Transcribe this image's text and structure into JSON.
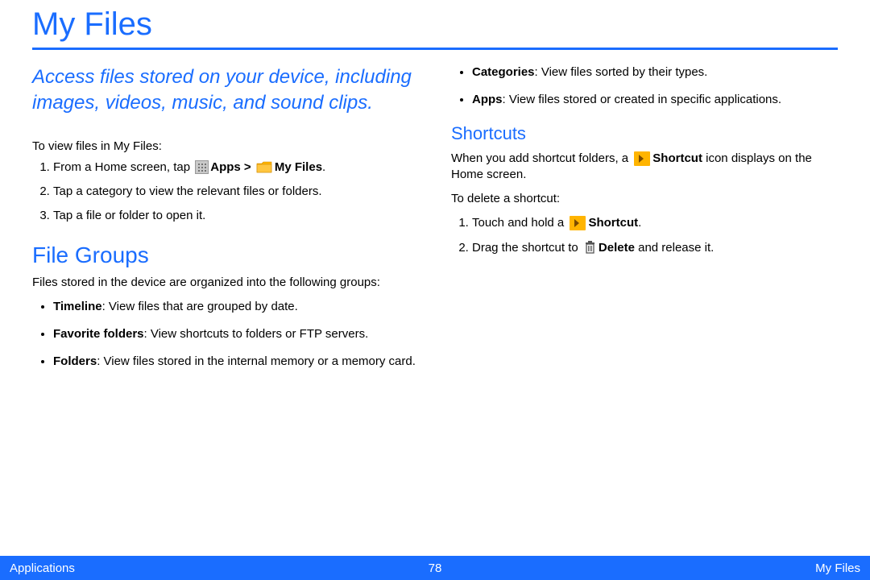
{
  "title": "My Files",
  "intro": "Access files stored on your device, including images, videos, music, and sound clips.",
  "view_lead": "To view files in My Files:",
  "step1_a": "From a Home screen, tap ",
  "step1_apps": "Apps > ",
  "step1_myfiles": "My Files",
  "step1_period": ".",
  "step2": "Tap a category to view the relevant files or folders.",
  "step3": "Tap a file or folder to open it.",
  "h2_filegroups": "File Groups",
  "filegroups_lead": "Files stored in the device are organized into the following groups:",
  "fg_timeline_b": "Timeline",
  "fg_timeline_t": ": View files that are grouped by date.",
  "fg_fav_b": "Favorite folders",
  "fg_fav_t": ": View shortcuts to folders or FTP servers.",
  "fg_folders_b": "Folders",
  "fg_folders_t": ": View files stored in the internal memory or a memory card.",
  "fg_cat_b": "Categories",
  "fg_cat_t": ": View files sorted by their types.",
  "fg_apps_b": "Apps",
  "fg_apps_t": ": View files stored or created in specific applications.",
  "h3_shortcuts": "Shortcuts",
  "sc_intro_a": "When you add shortcut folders, a ",
  "sc_intro_b": "Shortcut",
  "sc_intro_c": " icon displays on the Home screen.",
  "sc_delete_lead": "To delete a shortcut:",
  "sc_step1_a": "Touch and hold a ",
  "sc_step1_b": "Shortcut",
  "sc_step1_c": ".",
  "sc_step2_a": "Drag the shortcut to ",
  "sc_step2_b": "Delete",
  "sc_step2_c": " and release it.",
  "footer_left": "Applications",
  "footer_center": "78",
  "footer_right": "My Files"
}
